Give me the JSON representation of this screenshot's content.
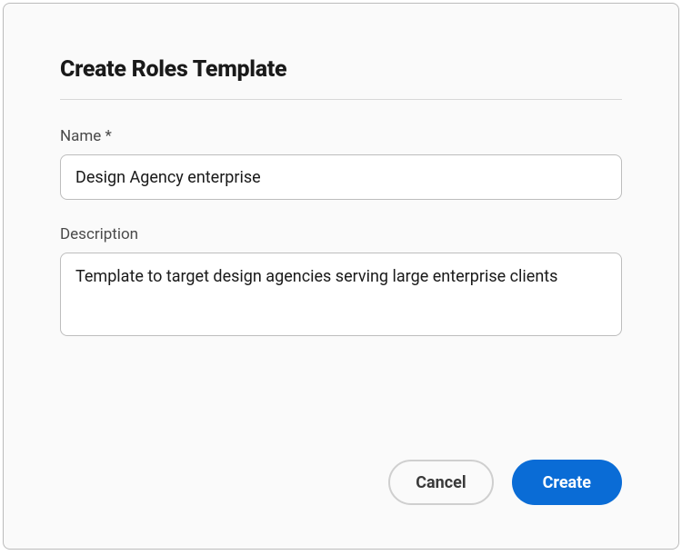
{
  "dialog": {
    "title": "Create Roles Template",
    "fields": {
      "name": {
        "label": "Name *",
        "value": "Design Agency enterprise"
      },
      "description": {
        "label": "Description",
        "value": "Template to target design agencies serving large enterprise clients"
      }
    },
    "buttons": {
      "cancel": "Cancel",
      "create": "Create"
    }
  }
}
